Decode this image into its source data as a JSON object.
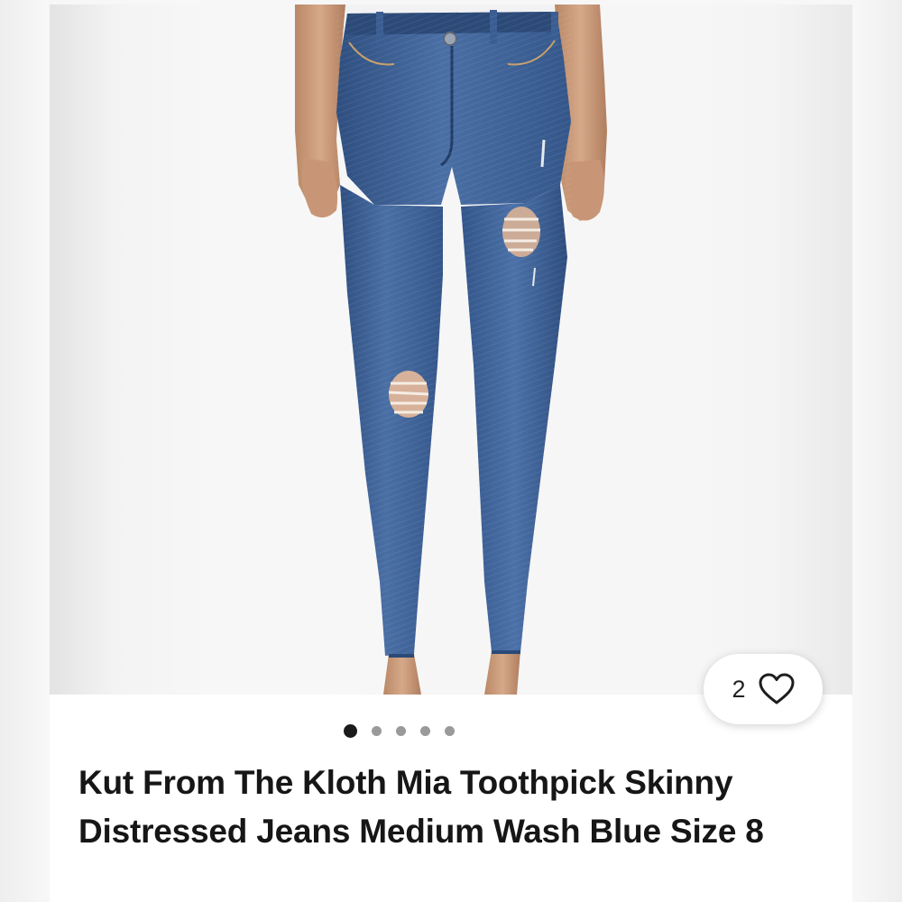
{
  "listing": {
    "title": "Kut From The Kloth Mia Toothpick Skinny Distressed Jeans Medium Wash Blue Size 8",
    "image": {
      "subject": "distressed medium wash skinny jeans",
      "icon": "product-photo"
    },
    "likes": {
      "count": "2",
      "icon": "heart-outline-icon"
    },
    "carousel": {
      "total": 5,
      "active_index": 0
    }
  },
  "colors": {
    "denim": "#3c5f94",
    "text": "#161616",
    "dot_active": "#1a1a1a",
    "dot_inactive": "#9a9a9a"
  }
}
